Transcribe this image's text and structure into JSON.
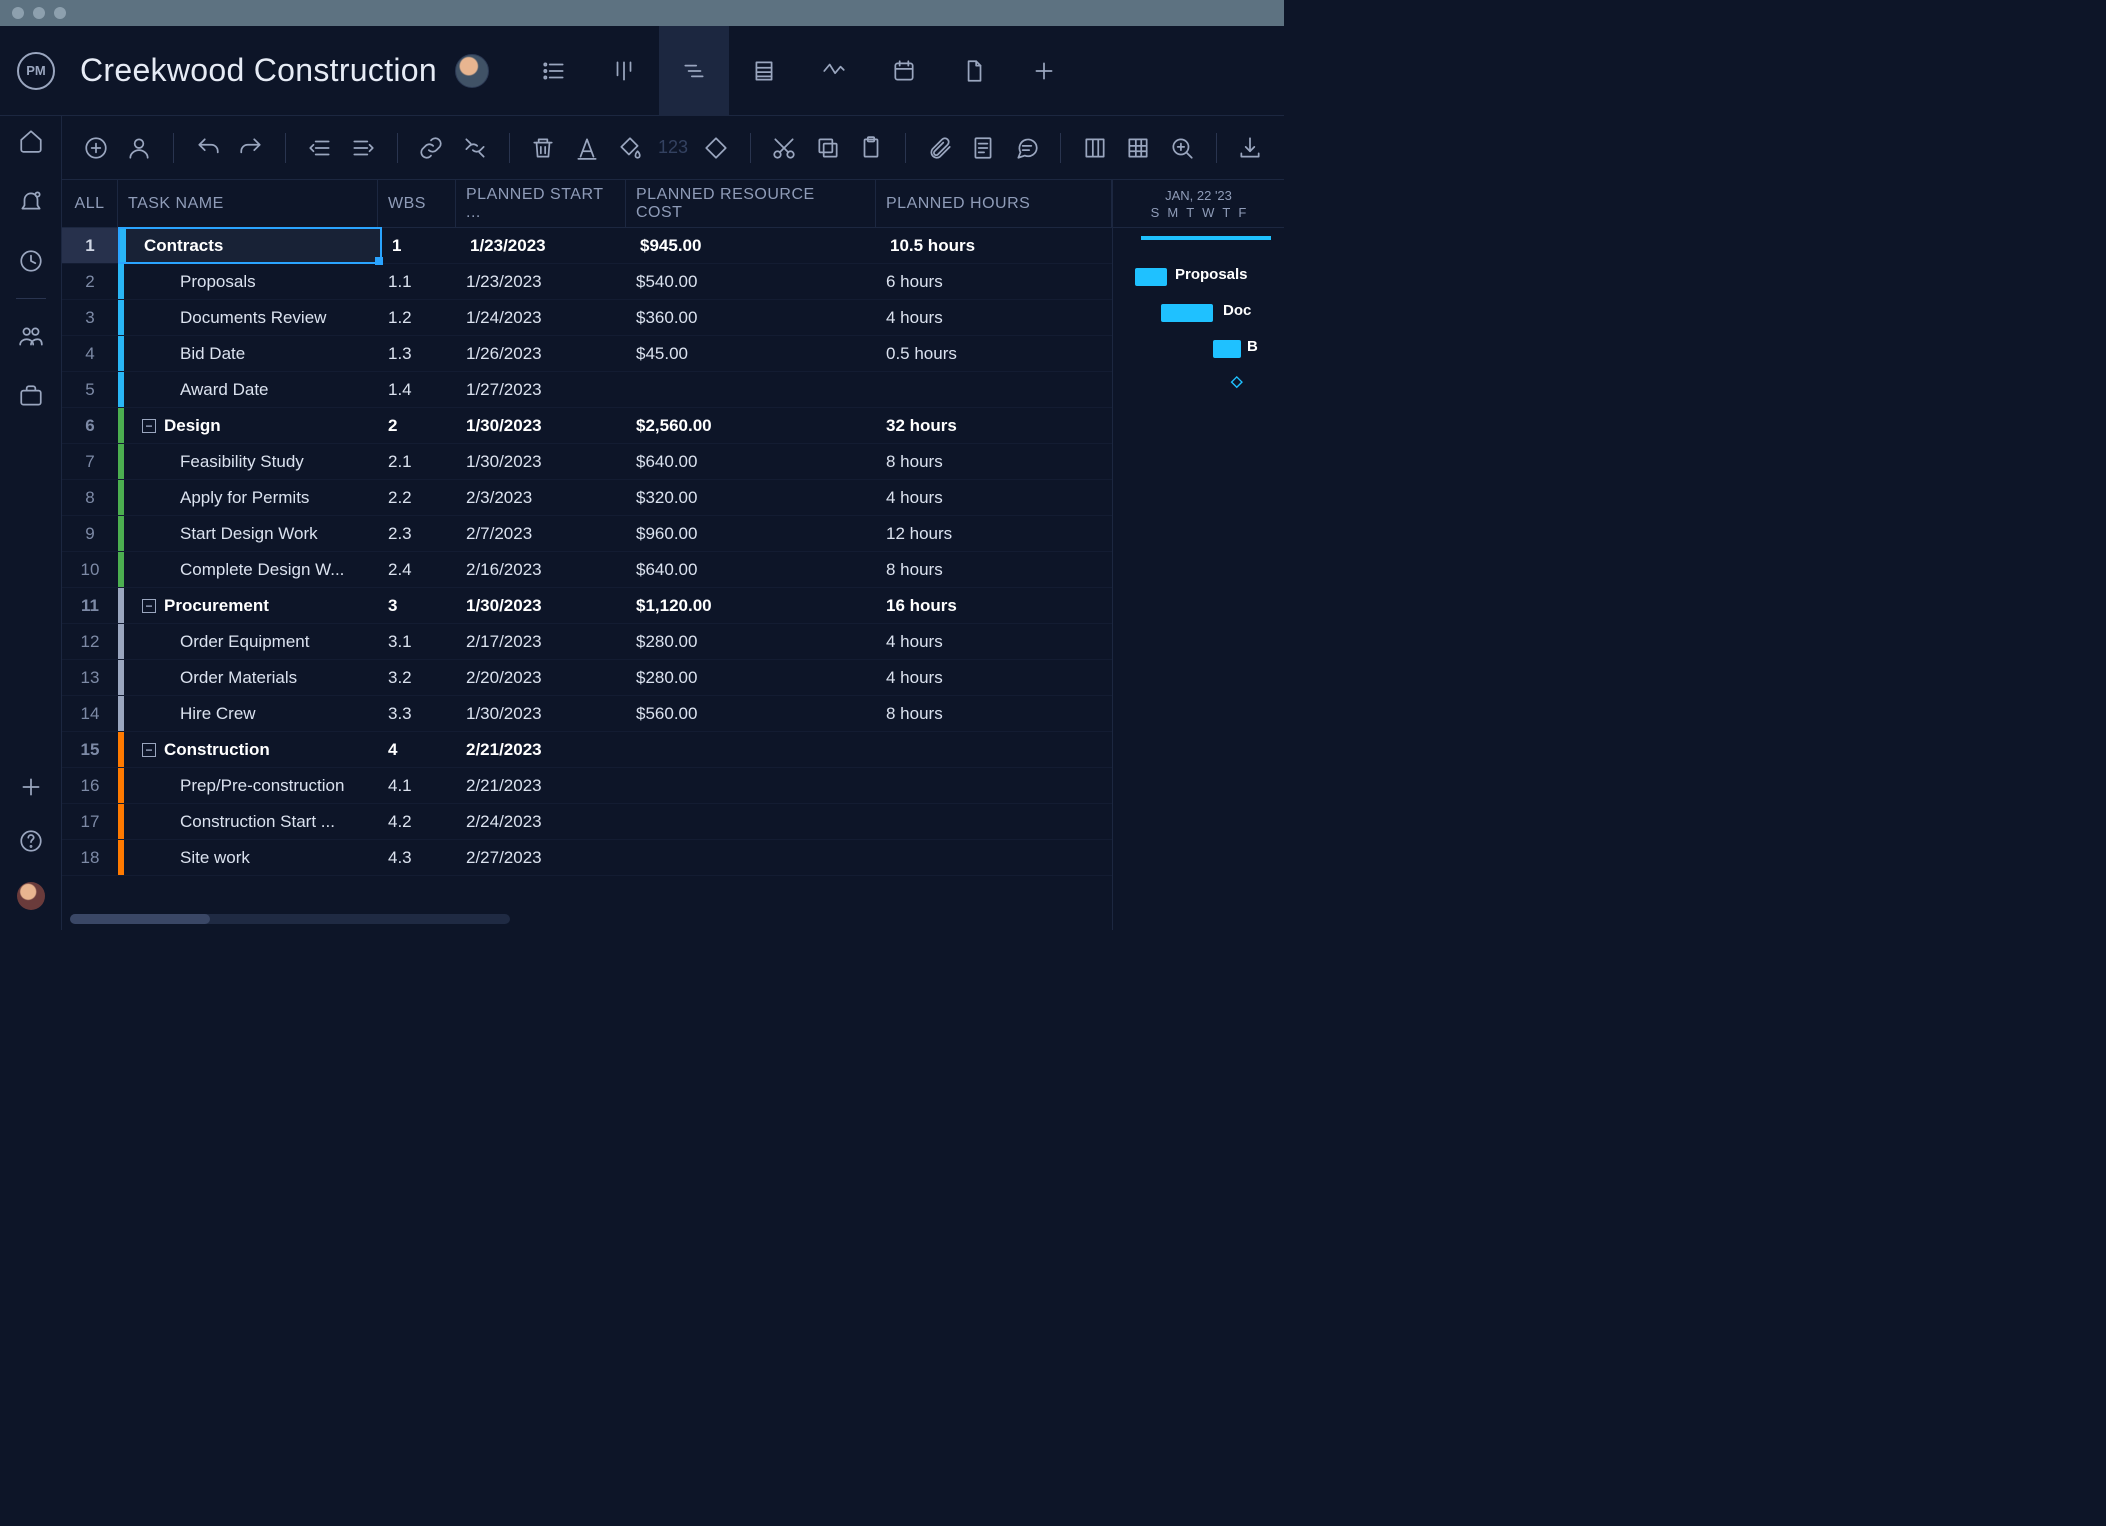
{
  "app": {
    "logo_text": "PM"
  },
  "project": {
    "title": "Creekwood Construction"
  },
  "columns": {
    "all": "ALL",
    "name": "TASK NAME",
    "wbs": "WBS",
    "start": "PLANNED START ...",
    "cost": "PLANNED RESOURCE COST",
    "hours": "PLANNED HOURS"
  },
  "toolbar": {
    "num_placeholder": "123"
  },
  "gantt": {
    "header_title": "JAN, 22 '23",
    "days": [
      "S",
      "M",
      "T",
      "W",
      "T",
      "F"
    ],
    "labels": {
      "proposals": "Proposals",
      "documents": "Doc",
      "bid": "B"
    }
  },
  "rows": [
    {
      "n": "1",
      "name": "Contracts",
      "wbs": "1",
      "start": "1/23/2023",
      "cost": "$945.00",
      "hours": "10.5 hours",
      "phase": true,
      "color": "c-blue",
      "selected": true,
      "collapse": false
    },
    {
      "n": "2",
      "name": "Proposals",
      "wbs": "1.1",
      "start": "1/23/2023",
      "cost": "$540.00",
      "hours": "6 hours",
      "phase": false,
      "color": "c-blue"
    },
    {
      "n": "3",
      "name": "Documents Review",
      "wbs": "1.2",
      "start": "1/24/2023",
      "cost": "$360.00",
      "hours": "4 hours",
      "phase": false,
      "color": "c-blue"
    },
    {
      "n": "4",
      "name": "Bid Date",
      "wbs": "1.3",
      "start": "1/26/2023",
      "cost": "$45.00",
      "hours": "0.5 hours",
      "phase": false,
      "color": "c-blue"
    },
    {
      "n": "5",
      "name": "Award Date",
      "wbs": "1.4",
      "start": "1/27/2023",
      "cost": "",
      "hours": "",
      "phase": false,
      "color": "c-blue"
    },
    {
      "n": "6",
      "name": "Design",
      "wbs": "2",
      "start": "1/30/2023",
      "cost": "$2,560.00",
      "hours": "32 hours",
      "phase": true,
      "color": "c-green",
      "collapse": true
    },
    {
      "n": "7",
      "name": "Feasibility Study",
      "wbs": "2.1",
      "start": "1/30/2023",
      "cost": "$640.00",
      "hours": "8 hours",
      "phase": false,
      "color": "c-green"
    },
    {
      "n": "8",
      "name": "Apply for Permits",
      "wbs": "2.2",
      "start": "2/3/2023",
      "cost": "$320.00",
      "hours": "4 hours",
      "phase": false,
      "color": "c-green"
    },
    {
      "n": "9",
      "name": "Start Design Work",
      "wbs": "2.3",
      "start": "2/7/2023",
      "cost": "$960.00",
      "hours": "12 hours",
      "phase": false,
      "color": "c-green"
    },
    {
      "n": "10",
      "name": "Complete Design W...",
      "wbs": "2.4",
      "start": "2/16/2023",
      "cost": "$640.00",
      "hours": "8 hours",
      "phase": false,
      "color": "c-green"
    },
    {
      "n": "11",
      "name": "Procurement",
      "wbs": "3",
      "start": "1/30/2023",
      "cost": "$1,120.00",
      "hours": "16 hours",
      "phase": true,
      "color": "c-grey",
      "collapse": true
    },
    {
      "n": "12",
      "name": "Order Equipment",
      "wbs": "3.1",
      "start": "2/17/2023",
      "cost": "$280.00",
      "hours": "4 hours",
      "phase": false,
      "color": "c-grey"
    },
    {
      "n": "13",
      "name": "Order Materials",
      "wbs": "3.2",
      "start": "2/20/2023",
      "cost": "$280.00",
      "hours": "4 hours",
      "phase": false,
      "color": "c-grey"
    },
    {
      "n": "14",
      "name": "Hire Crew",
      "wbs": "3.3",
      "start": "1/30/2023",
      "cost": "$560.00",
      "hours": "8 hours",
      "phase": false,
      "color": "c-grey"
    },
    {
      "n": "15",
      "name": "Construction",
      "wbs": "4",
      "start": "2/21/2023",
      "cost": "",
      "hours": "",
      "phase": true,
      "color": "c-orange",
      "collapse": true
    },
    {
      "n": "16",
      "name": "Prep/Pre-construction",
      "wbs": "4.1",
      "start": "2/21/2023",
      "cost": "",
      "hours": "",
      "phase": false,
      "color": "c-orange"
    },
    {
      "n": "17",
      "name": "Construction Start ...",
      "wbs": "4.2",
      "start": "2/24/2023",
      "cost": "",
      "hours": "",
      "phase": false,
      "color": "c-orange"
    },
    {
      "n": "18",
      "name": "Site work",
      "wbs": "4.3",
      "start": "2/27/2023",
      "cost": "",
      "hours": "",
      "phase": false,
      "color": "c-orange"
    }
  ]
}
